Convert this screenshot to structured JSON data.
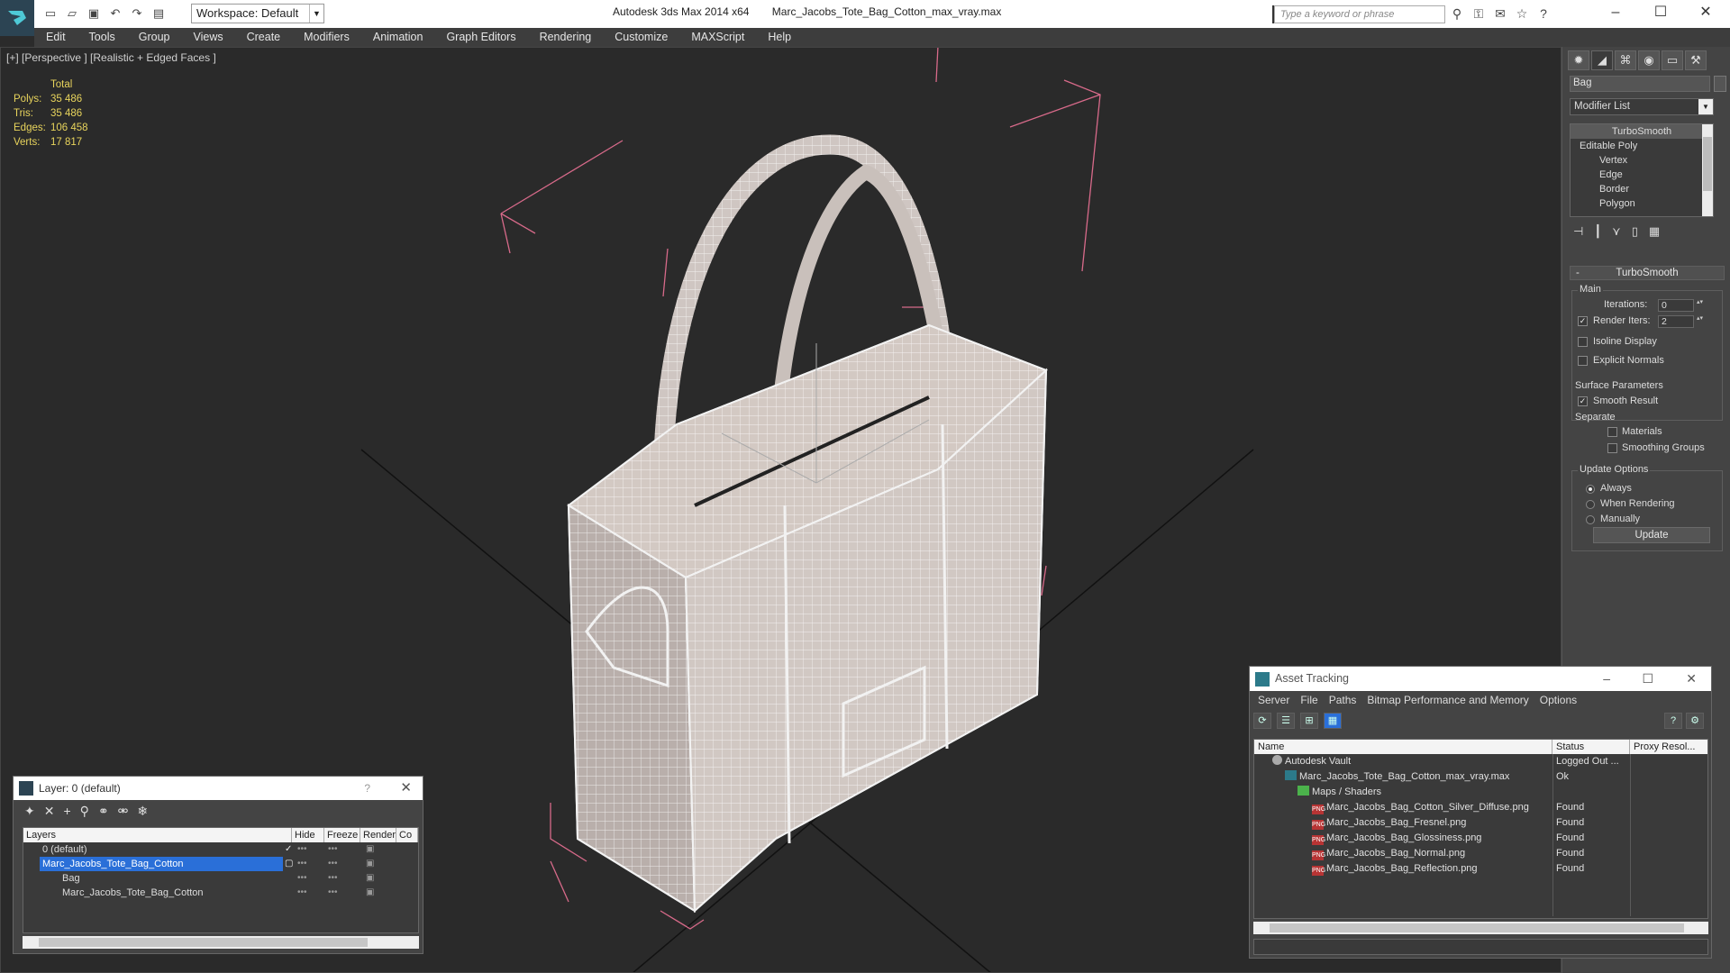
{
  "titlebar": {
    "app_name": "Autodesk 3ds Max  2014 x64",
    "file_name": "Marc_Jacobs_Tote_Bag_Cotton_max_vray.max",
    "workspace": "Workspace: Default",
    "search_placeholder": "Type a keyword or phrase"
  },
  "menu": [
    "Edit",
    "Tools",
    "Group",
    "Views",
    "Create",
    "Modifiers",
    "Animation",
    "Graph Editors",
    "Rendering",
    "Customize",
    "MAXScript",
    "Help"
  ],
  "viewport": {
    "label": "[+] [Perspective ] [Realistic + Edged Faces ]",
    "stats_header": "Total",
    "stats": [
      {
        "k": "Polys:",
        "v": "35 486"
      },
      {
        "k": "Tris:",
        "v": "35 486"
      },
      {
        "k": "Edges:",
        "v": "106 458"
      },
      {
        "k": "Verts:",
        "v": "17 817"
      }
    ]
  },
  "command_panel": {
    "object_name": "Bag",
    "modifier_list": "Modifier List",
    "stack": [
      "TurboSmooth",
      "Editable Poly",
      "Vertex",
      "Edge",
      "Border",
      "Polygon"
    ],
    "rollout": "TurboSmooth",
    "main_group": "Main",
    "iterations_label": "Iterations:",
    "iterations_value": "0",
    "render_iters_label": "Render Iters:",
    "render_iters_value": "2",
    "isoline": "Isoline Display",
    "explicit": "Explicit Normals",
    "surface_group": "Surface Parameters",
    "smooth_result": "Smooth Result",
    "separate": "Separate",
    "materials": "Materials",
    "smoothing_groups": "Smoothing Groups",
    "update_group": "Update Options",
    "always": "Always",
    "when_rendering": "When Rendering",
    "manually": "Manually",
    "update_button": "Update"
  },
  "layer_window": {
    "title": "Layer: 0 (default)",
    "help": "?",
    "cols": [
      "Layers",
      "Hide",
      "Freeze",
      "Render",
      "Co"
    ],
    "rows": [
      {
        "name": "0 (default)",
        "indent": 0
      },
      {
        "name": "Marc_Jacobs_Tote_Bag_Cotton",
        "indent": 0
      },
      {
        "name": "Bag",
        "indent": 1
      },
      {
        "name": "Marc_Jacobs_Tote_Bag_Cotton",
        "indent": 1
      }
    ]
  },
  "asset_window": {
    "title": "Asset Tracking",
    "menu": [
      "Server",
      "File",
      "Paths",
      "Bitmap Performance and Memory",
      "Options"
    ],
    "cols": [
      "Name",
      "Status",
      "Proxy Resol..."
    ],
    "rows": [
      {
        "name": "Autodesk Vault",
        "status": "Logged Out ...",
        "icon": "vault"
      },
      {
        "name": "Marc_Jacobs_Tote_Bag_Cotton_max_vray.max",
        "status": "Ok",
        "icon": "max"
      },
      {
        "name": "Maps / Shaders",
        "status": "",
        "icon": "fold"
      },
      {
        "name": "Marc_Jacobs_Bag_Cotton_Silver_Diffuse.png",
        "status": "Found",
        "icon": "png"
      },
      {
        "name": "Marc_Jacobs_Bag_Fresnel.png",
        "status": "Found",
        "icon": "png"
      },
      {
        "name": "Marc_Jacobs_Bag_Glossiness.png",
        "status": "Found",
        "icon": "png"
      },
      {
        "name": "Marc_Jacobs_Bag_Normal.png",
        "status": "Found",
        "icon": "png"
      },
      {
        "name": "Marc_Jacobs_Bag_Reflection.png",
        "status": "Found",
        "icon": "png"
      }
    ]
  },
  "colors": {
    "viewport_bg": "#2a2a2a",
    "stats_text": "#e8d45c",
    "selection": "#2a6fd8",
    "bbox": "#d86a8a",
    "panel": "#444444"
  }
}
